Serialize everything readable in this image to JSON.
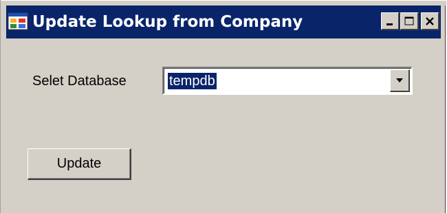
{
  "window": {
    "title": "Update Lookup from Company",
    "title_bar_color": "#0a246a",
    "background_color": "#d4d0c8",
    "icon": "app-form-icon",
    "caption_buttons": [
      "minimize-icon",
      "maximize-icon",
      "close-icon"
    ]
  },
  "form": {
    "database_label": "Selet Database",
    "database_select": {
      "selected_value": "tempdb",
      "arrow_icon": "chevron-down-icon"
    },
    "update_button_label": "Update"
  }
}
